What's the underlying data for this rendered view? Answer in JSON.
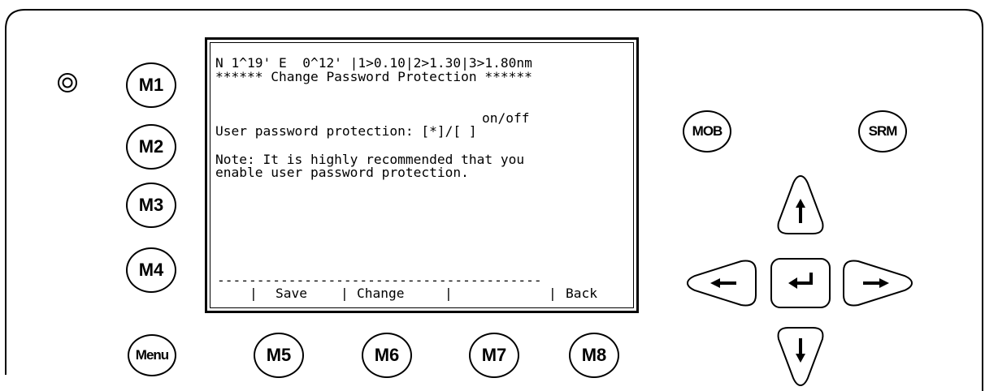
{
  "device": {
    "power_indicator": "power-led",
    "side_buttons": [
      "M1",
      "M2",
      "M3",
      "M4"
    ],
    "menu_button": "Menu",
    "bottom_buttons": [
      "M5",
      "M6",
      "M7",
      "M8"
    ],
    "mob_button": "MOB",
    "srm_button": "SRM",
    "nav_icons": [
      "arrow-up-icon",
      "arrow-left-icon",
      "enter-icon",
      "arrow-right-icon",
      "arrow-down-icon"
    ]
  },
  "screen": {
    "status_line": "N 1^19' E  0^12' |1>0.10|2>1.30|3>1.80nm",
    "title": "****** Change Password Protection ******",
    "onoff_header": "on/off",
    "option_label": "User password protection: [*]/[ ]",
    "note_line1": "Note: It is highly recommended that you",
    "note_line2": "enable user password protection.",
    "separator": "-----------------------------------------",
    "softkeys": {
      "sep1": "|",
      "save": "Save",
      "sep2": "|",
      "change": "Change",
      "sep3": "|",
      "sep4": "|",
      "back": "Back"
    }
  }
}
